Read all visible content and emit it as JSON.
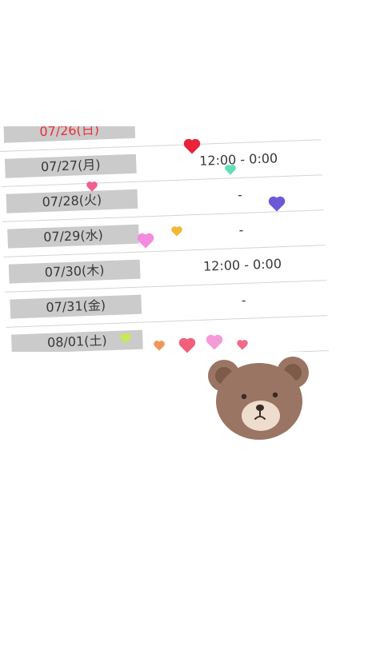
{
  "schedule": {
    "rows": [
      {
        "date": "07/26(日)",
        "time": "-",
        "sunday": true
      },
      {
        "date": "07/27(月)",
        "time": "12:00 - 0:00",
        "sunday": false
      },
      {
        "date": "07/28(火)",
        "time": "-",
        "sunday": false
      },
      {
        "date": "07/29(水)",
        "time": "-",
        "sunday": false
      },
      {
        "date": "07/30(木)",
        "time": "12:00 - 0:00",
        "sunday": false
      },
      {
        "date": "07/31(金)",
        "time": "-",
        "sunday": false
      },
      {
        "date": "08/01(土)",
        "time": "",
        "sunday": false
      }
    ]
  },
  "decor": {
    "bear_icon": "bear-face-icon",
    "heart_colors": [
      "#e8243a",
      "#ef5f8f",
      "#6a5ad8",
      "#f58be0",
      "#f0b93a",
      "#5fe0b5",
      "#c8e85a",
      "#f2955a",
      "#f0607a",
      "#f59ad8",
      "#f06a8a"
    ]
  }
}
